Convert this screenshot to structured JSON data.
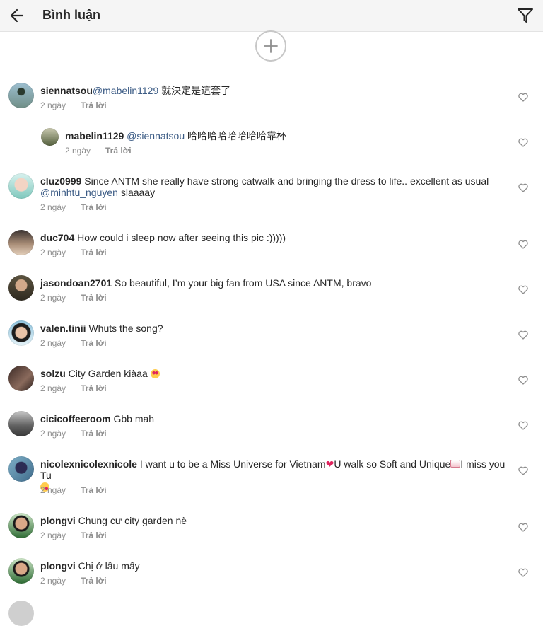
{
  "header": {
    "title": "Bình luận",
    "back_icon": "arrow-left-icon",
    "filter_icon": "filter-icon"
  },
  "load_more_icon": "plus-circle-icon",
  "reply_label": "Trả lời",
  "comments": [
    {
      "username": "siennatsou",
      "mention": "@mabelin1129",
      "text": " 就決定是這套了",
      "time": "2 ngày"
    },
    {
      "username": "mabelin1129",
      "mention": "@siennatsou",
      "text": " 哈哈哈哈哈哈哈哈靠杯",
      "time": "2 ngày"
    },
    {
      "username": "cluz0999",
      "text": " Since ANTM she really have strong catwalk and bringing the dress to life.. excellent as usual ",
      "mention": "@minhtu_nguyen",
      "text_after": " slaaaay",
      "time": "2 ngày"
    },
    {
      "username": "duc704",
      "text": " How could i sleep now after seeing this pic :)))))",
      "time": "2 ngày"
    },
    {
      "username": "jasondoan2701",
      "text": " So beautiful, I’m your big fan from USA since ANTM, bravo",
      "time": "2 ngày"
    },
    {
      "username": "valen.tinii",
      "text": " Whuts the song?",
      "time": "2 ngày"
    },
    {
      "username": "solzu",
      "text": " City Garden kiàaa ",
      "time": "2 ngày"
    },
    {
      "username": "cicicoffeeroom",
      "text": " Gbb mah",
      "time": "2 ngày"
    },
    {
      "username": "nicolexnicolexnicole",
      "text": " I want u to be a Miss Universe for Vietnam",
      "text_mid": "U walk so Soft and Unique",
      "text_after": "I miss you Tu",
      "time": "2 ngày"
    },
    {
      "username": "plongvi",
      "text": " Chung cư city garden nè",
      "time": "2 ngày"
    },
    {
      "username": "plongvi",
      "text": " Chị ở lầu mấy",
      "time": "2 ngày"
    }
  ],
  "colors": {
    "header_bg": "#f5f5f5",
    "text": "#262626",
    "mention": "#3a5a84",
    "meta": "#8e8e8e"
  }
}
